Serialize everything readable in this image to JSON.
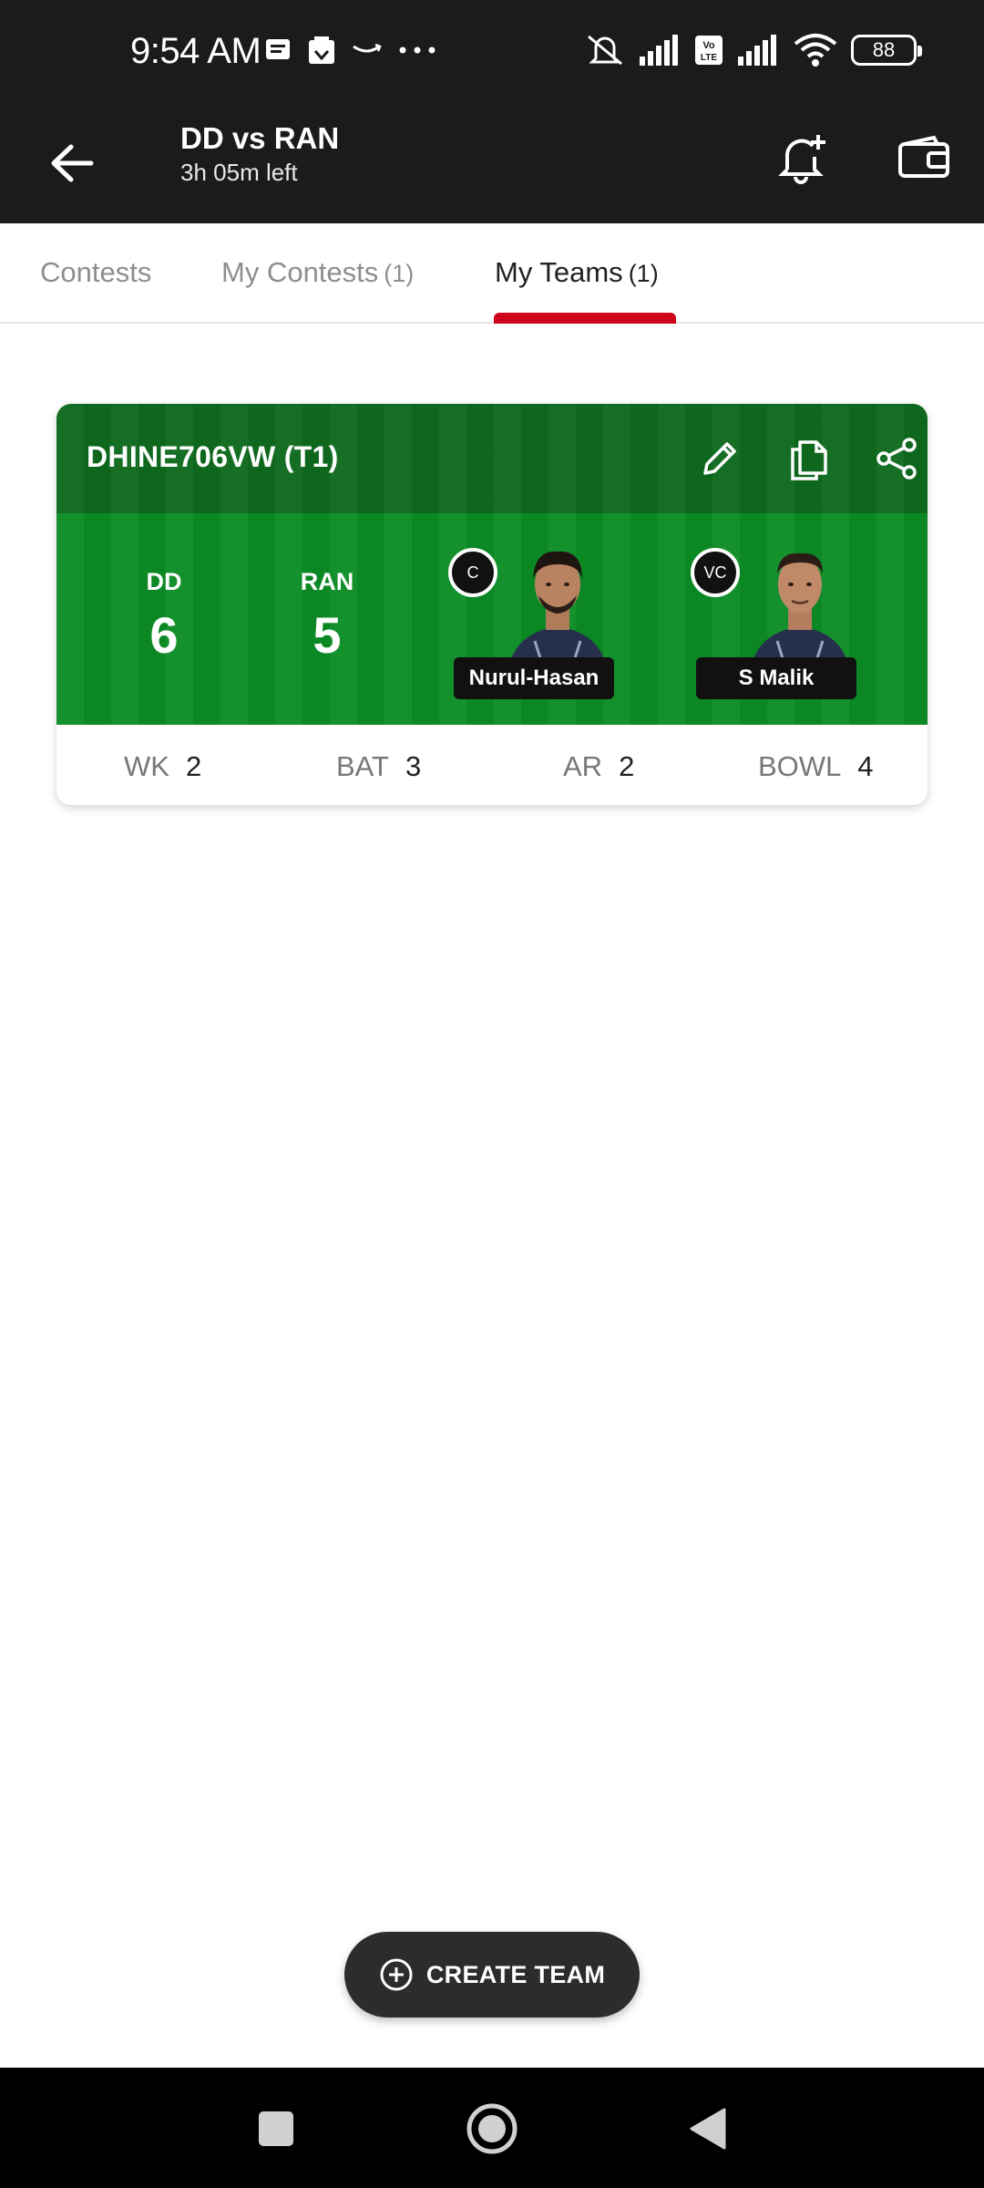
{
  "status_bar": {
    "time": "9:54 AM",
    "battery": "88",
    "icons": [
      "message-icon",
      "app-icon",
      "amazon-icon",
      "more-dots-icon",
      "mute-icon",
      "signal-icon",
      "volte-icon",
      "signal-icon",
      "wifi-icon",
      "battery-icon"
    ]
  },
  "app_bar": {
    "title": "DD vs RAN",
    "subtitle": "3h 05m left",
    "icons": [
      "back-arrow-icon",
      "bell-plus-icon",
      "wallet-icon"
    ]
  },
  "tabs": [
    {
      "label": "Contests",
      "count": ""
    },
    {
      "label": "My Contests",
      "count": "(1)"
    },
    {
      "label": "My Teams",
      "count": "(1)",
      "active": true
    }
  ],
  "team_card": {
    "name": "DHINE706VW (T1)",
    "header_icons": [
      "edit-icon",
      "copy-icon",
      "share-icon"
    ],
    "teams": [
      {
        "abbr": "DD",
        "count": "6"
      },
      {
        "abbr": "RAN",
        "count": "5"
      }
    ],
    "captain": {
      "badge": "C",
      "name": "Nurul-Hasan"
    },
    "vice_captain": {
      "badge": "VC",
      "name": "S Malik"
    },
    "roles": [
      {
        "label": "WK",
        "count": "2"
      },
      {
        "label": "BAT",
        "count": "3"
      },
      {
        "label": "AR",
        "count": "2"
      },
      {
        "label": "BOWL",
        "count": "4"
      }
    ]
  },
  "create_button": {
    "label": "CREATE TEAM",
    "icon": "plus-circle-icon"
  },
  "colors": {
    "dark_bar": "#1b1b1b",
    "accent_red": "#d0021b",
    "pitch_green": "#0b8c25",
    "pitch_dark_green": "#0e6a1e"
  }
}
